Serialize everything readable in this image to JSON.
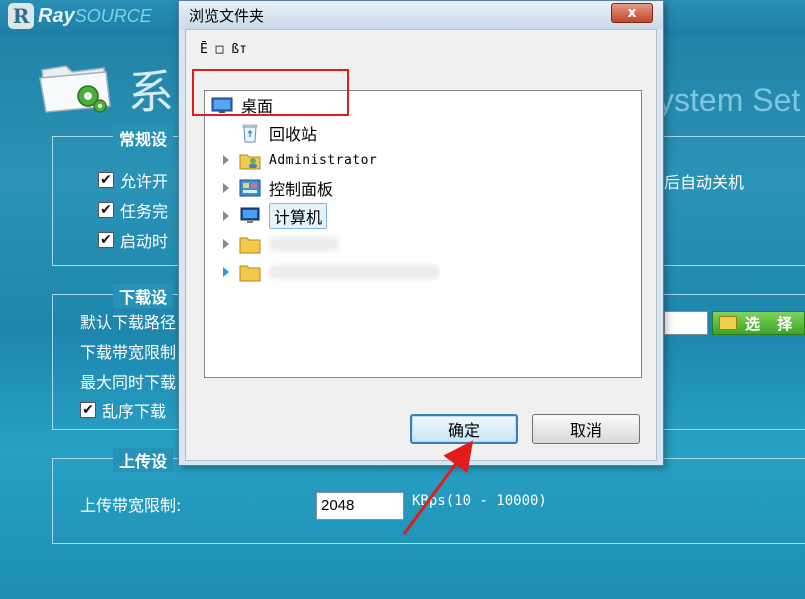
{
  "app": {
    "logo_bold": "Ray",
    "logo_light": "SOURCE",
    "title_cn": "系",
    "title_en": "ystem Set"
  },
  "general": {
    "title": "常规设",
    "options": [
      {
        "label": "允许开",
        "checked": true
      },
      {
        "label": "任务完",
        "checked": true
      },
      {
        "label": "启动时",
        "checked": true
      }
    ],
    "right_text": "后自动关机"
  },
  "download": {
    "title": "下载设",
    "rows": [
      "默认下载路径",
      "下载带宽限制",
      "最大同时下载"
    ],
    "shuffle_label": "乱序下载",
    "shuffle_checked": true,
    "select_button": "选 择"
  },
  "upload": {
    "title": "上传设",
    "bandwidth_label": "上传带宽限制:",
    "bandwidth_value": "2048",
    "unit_hint": "KBps(10 - 10000)"
  },
  "dialog": {
    "title": "浏览文件夹",
    "close_symbol": "x",
    "toolbar_text": "Ē  □ ßт",
    "tree": [
      {
        "label": "桌面",
        "icon": "desktop-icon",
        "selected": true
      },
      {
        "label": "回收站",
        "icon": "recycle-bin-icon"
      },
      {
        "label": "Administrator",
        "icon": "user-folder-icon"
      },
      {
        "label": "控制面板",
        "icon": "control-panel-icon"
      },
      {
        "label": "计算机",
        "icon": "computer-icon"
      }
    ],
    "ok_button": "确定",
    "cancel_button": "取消"
  },
  "colors": {
    "background": "#2792b6",
    "highlight": "#e31b1b",
    "select_button": "#4caf33"
  }
}
